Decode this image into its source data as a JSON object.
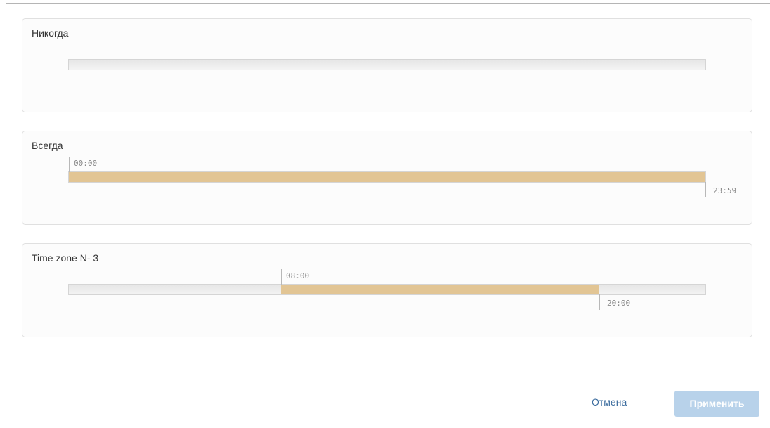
{
  "zones": [
    {
      "title": "Никогда",
      "interval": null
    },
    {
      "title": "Всегда",
      "interval": {
        "start": "00:00",
        "end": "23:59",
        "start_fraction": 0.0,
        "end_fraction": 1.0
      }
    },
    {
      "title": "Time zone N- 3",
      "interval": {
        "start": "08:00",
        "end": "20:00",
        "start_fraction": 0.3333,
        "end_fraction": 0.8333
      }
    }
  ],
  "footer": {
    "cancel_label": "Отмена",
    "apply_label": "Применить"
  },
  "colors": {
    "interval_fill": "#e2c594",
    "apply_button": "#b8d2ea",
    "cancel_link": "#3b6c9e"
  }
}
